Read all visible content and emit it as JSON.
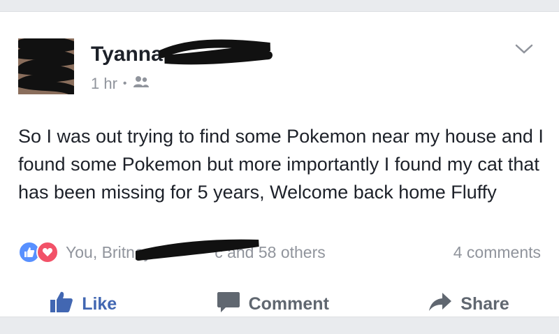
{
  "post": {
    "author_first_name": "Tyanna",
    "time": "1 hr",
    "separator": "•",
    "audience_icon": "friends-icon",
    "text": "So I was out trying to find some Pokemon near my house and I found some Pokemon but more importantly I found my cat that has been missing for 5 years, Welcome back home Fluffy"
  },
  "reactions": {
    "icons": [
      "like-reaction-icon",
      "love-reaction-icon"
    ],
    "names_text": "You, Britney",
    "names_tail": "c and 58 others",
    "comments": "4 comments"
  },
  "actions": {
    "like": "Like",
    "comment": "Comment",
    "share": "Share"
  },
  "colors": {
    "brand_blue": "#4267b2",
    "like_blue": "#5890ff",
    "love_red": "#f25268",
    "muted_gray": "#90949c",
    "text": "#1d2129"
  }
}
